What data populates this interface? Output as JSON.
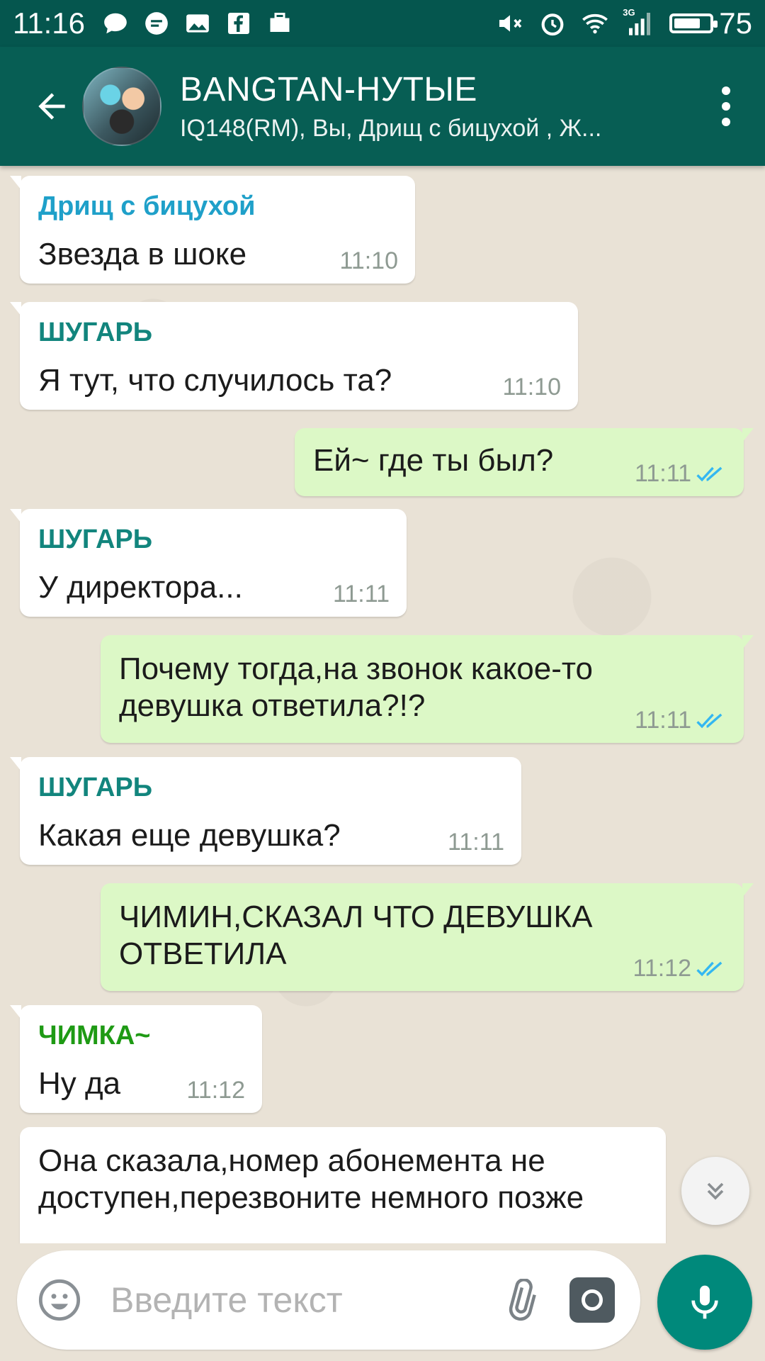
{
  "status_bar": {
    "time": "11:16",
    "battery_percent": "75",
    "battery_level": 0.75,
    "network_label": "3G",
    "left_icons": [
      "chat-bubble-icon",
      "message-icon",
      "image-icon",
      "facebook-icon",
      "briefcase-icon"
    ],
    "right_icons": [
      "mute-icon",
      "alarm-icon",
      "wifi-icon",
      "signal-icon",
      "battery-icon"
    ]
  },
  "header": {
    "title": "BANGTAN-НУТЫЕ",
    "subtitle": "IQ148(RM), Вы, Дрищ с бицухой , Ж..."
  },
  "colors": {
    "status_bar": "#05564e",
    "header": "#075e54",
    "incoming_bubble": "#ffffff",
    "outgoing_bubble": "#dcf8c6",
    "read_ticks": "#34b7f1",
    "mic_button": "#00897b",
    "sender_drishch": "#1fa0c9",
    "sender_shugar": "#12857d",
    "sender_chimka": "#1e9a14"
  },
  "messages": [
    {
      "direction": "in",
      "sender": "Дрищ с бицухой",
      "text": "Звезда в шоке",
      "time": "11:10"
    },
    {
      "direction": "in",
      "sender": "ШУГАРЬ",
      "text": "Я тут, что случилось та?",
      "time": "11:10"
    },
    {
      "direction": "out",
      "text": "Ей~ где ты был?",
      "time": "11:11",
      "status": "read"
    },
    {
      "direction": "in",
      "sender": "ШУГАРЬ",
      "text": "У директора...",
      "time": "11:11"
    },
    {
      "direction": "out",
      "text": "Почему тогда,на звонок какое-то девушка ответила?!?",
      "time": "11:11",
      "status": "read"
    },
    {
      "direction": "in",
      "sender": "ШУГАРЬ",
      "text": "Какая еще девушка?",
      "time": "11:11"
    },
    {
      "direction": "out",
      "text": "ЧИМИН,СКАЗАЛ ЧТО ДЕВУШКА ОТВЕТИЛА",
      "time": "11:12",
      "status": "read"
    },
    {
      "direction": "in",
      "sender": "ЧИМКА~",
      "text": "Ну да",
      "time": "11:12"
    },
    {
      "direction": "in",
      "text": "Она сказала,номер абонемента не доступен,перезвоните немного позже",
      "time": ""
    }
  ],
  "input": {
    "placeholder": "Введите текст"
  }
}
